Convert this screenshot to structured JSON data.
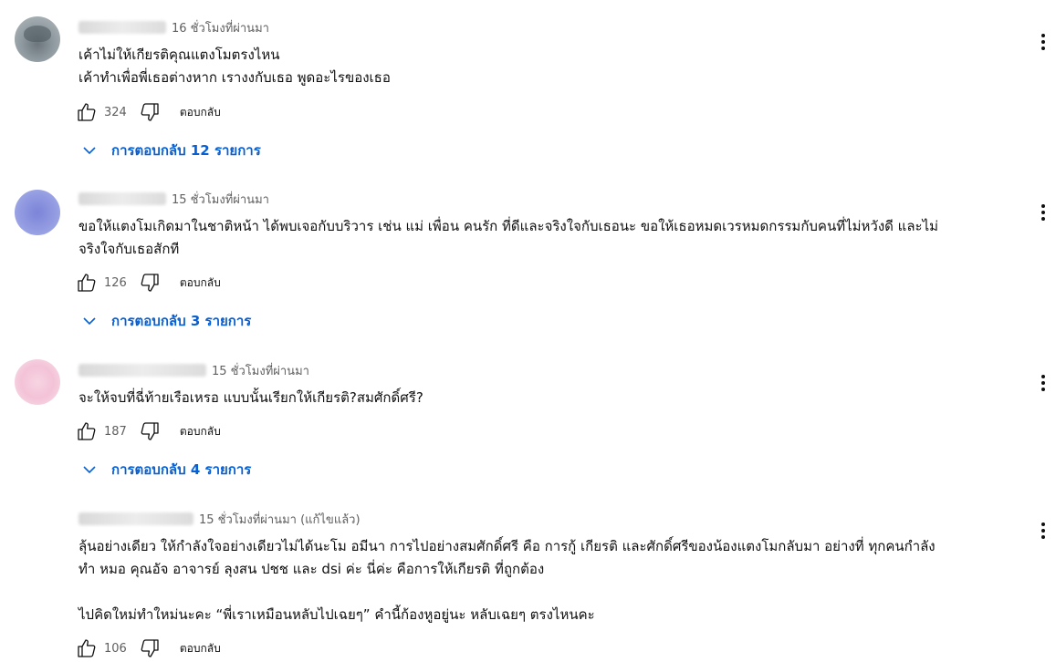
{
  "comments": [
    {
      "time": "16 ชั่วโมงที่ผ่านมา",
      "lines": [
        "เค้าไม่ให้เกียรติคุณแตงโมตรงไหน",
        "เค้าทำเพื่อพี่เธอต่างหาก เรางงกับเธอ พูดอะไรของเธอ"
      ],
      "likes": "324",
      "reply_label": "ตอบกลับ",
      "replies_label": "การตอบกลับ 12 รายการ"
    },
    {
      "time": "15 ชั่วโมงที่ผ่านมา",
      "lines": [
        "ขอให้แตงโมเกิดมาในชาติหน้า ได้พบเจอกับบริวาร เช่น แม่ เพื่อน คนรัก ที่ดีและจริงใจกับเธอนะ  ขอให้เธอหมดเวรหมดกรรมกับคนที่ไม่หวังดี และไม่",
        "จริงใจกับเธอสักที"
      ],
      "likes": "126",
      "reply_label": "ตอบกลับ",
      "replies_label": "การตอบกลับ 3 รายการ"
    },
    {
      "time": "15 ชั่วโมงที่ผ่านมา",
      "lines": [
        "จะให้จบที่ฉี่ท้ายเรือเหรอ แบบนั้นเรียกให้เกียรติ?สมศักดิ์ศรี?"
      ],
      "likes": "187",
      "reply_label": "ตอบกลับ",
      "replies_label": "การตอบกลับ 4 รายการ"
    },
    {
      "time": "15 ชั่วโมงที่ผ่านมา (แก้ไขแล้ว)",
      "lines": [
        "ลุ้นอย่างเดียว ให้กำลังใจอย่างเดียวไม่ได้นะโม อมีนา การไปอย่างสมศักดิ์ศรี คือ การกู้ เกียรติ และศักดิ์ศรีของน้องแตงโมกลับมา อย่างที่ ทุกคนกำลัง",
        "ทำ หมอ คุณอัจ อาจารย์ ลุงสน ปชช และ dsi  ค่ะ นี่ค่ะ คือการให้เกียรติ ที่ถูกต้อง",
        "",
        "ไปคิดใหม่ทำใหม่นะคะ  “พี่เราเหมือนหลับไปเฉยๆ” คำนี้ก้องหูอยู่นะ  หลับเฉยๆ ตรงไหนคะ"
      ],
      "likes": "106",
      "reply_label": "ตอบกลับ"
    }
  ],
  "icons": {
    "like": "thumbs-up-icon",
    "dislike": "thumbs-down-icon",
    "expand": "chevron-down-icon",
    "menu": "more-vert-icon"
  },
  "colors": {
    "link": "#065fd4",
    "meta": "#606060",
    "text": "#0f0f0f"
  }
}
